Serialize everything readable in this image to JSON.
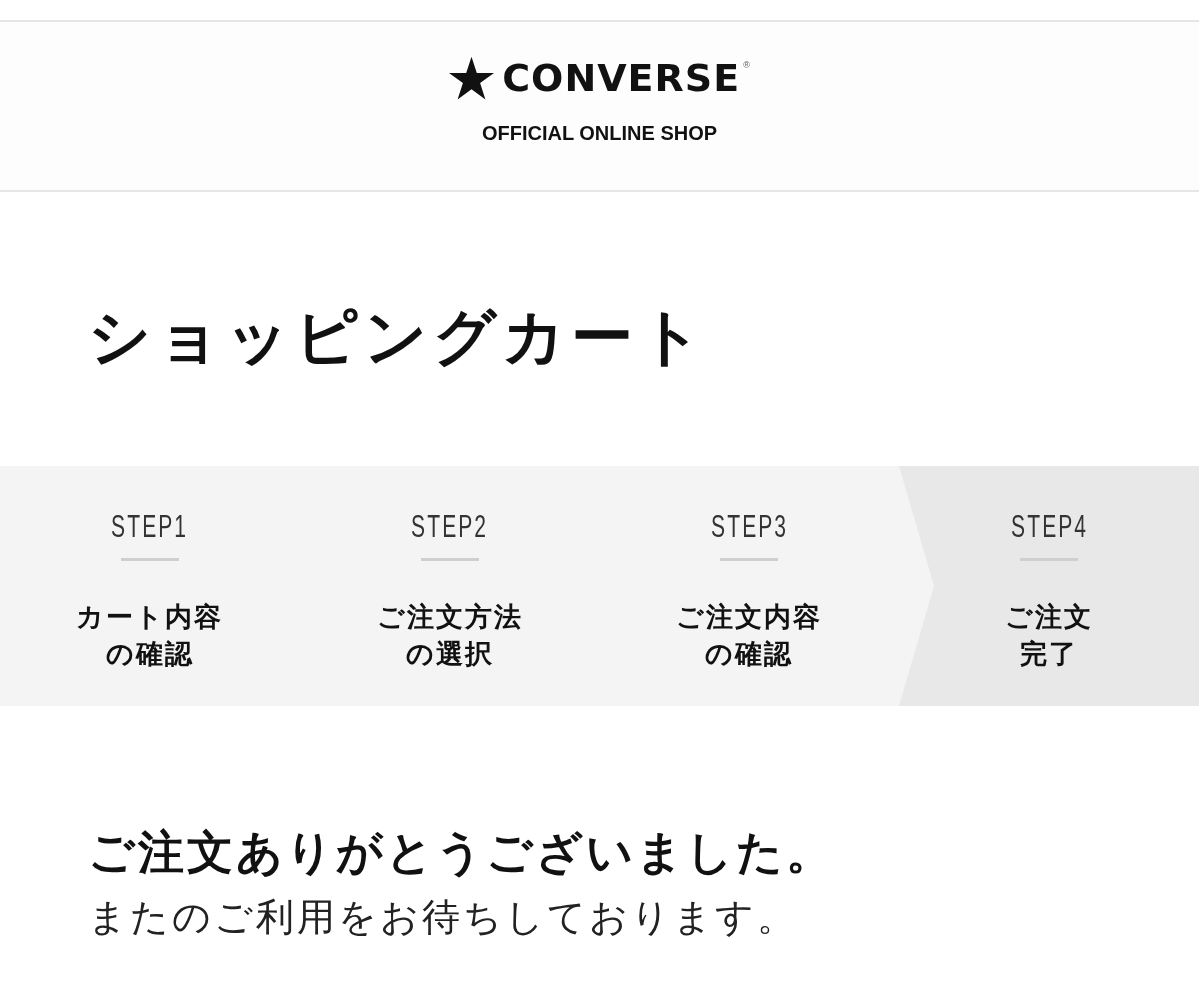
{
  "header": {
    "logo": {
      "wordmark": "CONVERSE",
      "registered_mark": "®"
    },
    "tagline": "OFFICIAL ONLINE SHOP"
  },
  "page_title": "ショッピングカート",
  "steps": [
    {
      "number": "STEP1",
      "label_lines": [
        "カート内容",
        "の確認"
      ],
      "selected": false
    },
    {
      "number": "STEP2",
      "label_lines": [
        "ご注文方法",
        "の選択"
      ],
      "selected": false
    },
    {
      "number": "STEP3",
      "label_lines": [
        "ご注文内容",
        "の確認"
      ],
      "selected": false
    },
    {
      "number": "STEP4",
      "label_lines": [
        "ご注文",
        "完了"
      ],
      "selected": true
    }
  ],
  "confirmation": {
    "heading": "ご注文ありがとうございました。",
    "message": "またのご利用をお待ちしております。"
  }
}
